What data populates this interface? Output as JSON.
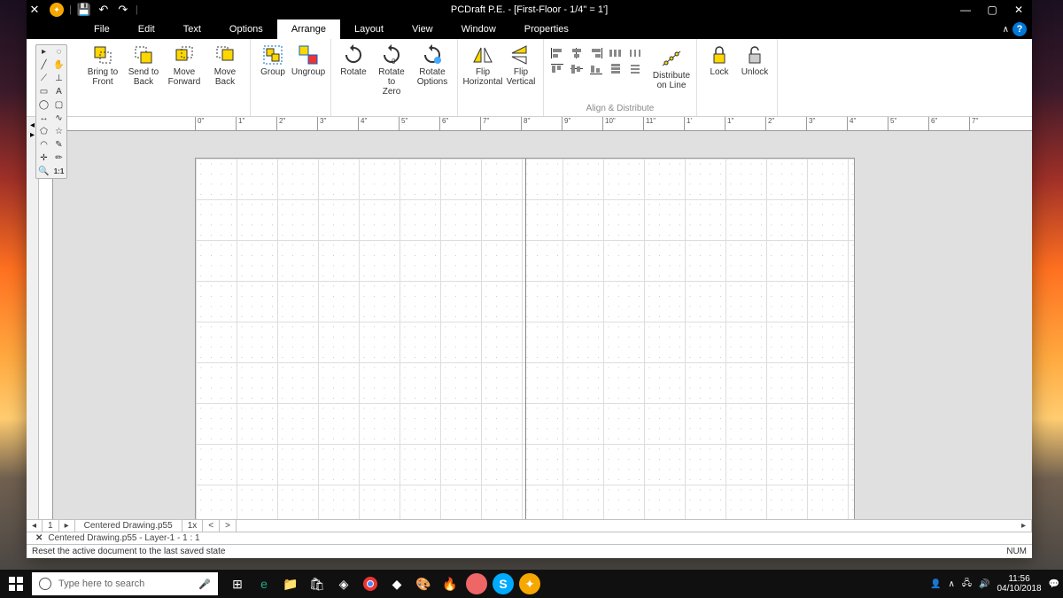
{
  "titlebar": {
    "title": "PCDraft P.E. - [First-Floor - 1/4\" = 1']"
  },
  "menu": {
    "file": "File",
    "edit": "Edit",
    "text": "Text",
    "options": "Options",
    "arrange": "Arrange",
    "layout": "Layout",
    "view": "View",
    "window": "Window",
    "properties": "Properties"
  },
  "ribbon": {
    "order": {
      "bring_front": "Bring to\nFront",
      "send_back": "Send to\nBack",
      "move_forward": "Move\nForward",
      "move_back": "Move\nBack"
    },
    "group": {
      "group": "Group",
      "ungroup": "Ungroup"
    },
    "rotate": {
      "rotate": "Rotate",
      "rotate_zero": "Rotate to\nZero",
      "rotate_options": "Rotate\nOptions"
    },
    "flip": {
      "flip_h": "Flip\nHorizontal",
      "flip_v": "Flip\nVertical"
    },
    "distribute": {
      "on_line": "Distribute\non Line"
    },
    "lock": {
      "lock": "Lock",
      "unlock": "Unlock"
    },
    "group_label": "Align & Distribute"
  },
  "ruler": {
    "ticks": [
      "0\"",
      "1\"",
      "2\"",
      "3\"",
      "4\"",
      "5\"",
      "6\"",
      "7\"",
      "8\"",
      "9\"",
      "10\"",
      "11\"",
      "1'",
      "1\"",
      "2\"",
      "3\"",
      "4\"",
      "5\"",
      "6\"",
      "7\""
    ]
  },
  "tabs": {
    "page_num": "1",
    "doc_tab": "Centered Drawing.p55",
    "zoom": "1x"
  },
  "layer": {
    "info": "Centered Drawing.p55 - Layer-1 - 1 : 1"
  },
  "status": {
    "message": "Reset the active document to the last saved state",
    "right": "NUM"
  },
  "taskbar": {
    "search_placeholder": "Type here to search",
    "time": "11:56",
    "date": "04/10/2018"
  },
  "tools": {
    "ratio": "1:1"
  }
}
